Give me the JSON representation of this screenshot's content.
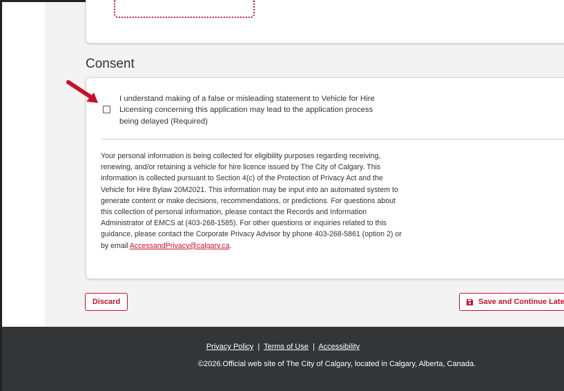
{
  "consent": {
    "title": "Consent",
    "checkbox_label": "I understand making of a false or misleading statement to Vehicle for Hire Licensing concerning this application may lead to the application process being delayed (Required)",
    "privacy_text": "Your personal information is being collected for eligibility purposes regarding receiving, renewing, and/or retaining a vehicle for hire licence issued by The City of Calgary. This information is collected pursuant to Section 4(c) of the Protection of Privacy Act and the Vehicle for Hire Bylaw 20M2021. This information may be input into an automated system to generate content or make decisions, recommendations, or predictions. For questions about this collection of personal information, please contact the Records and Information Administrator of EMCS at (403-268-1585). For other questions or inquiries related to this guidance, please contact the Corporate Privacy Advisor by phone 403-268-5861 (option 2) or by email",
    "privacy_email": "AccessandPrivacy@calgary.ca",
    "privacy_end": "."
  },
  "actions": {
    "discard_label": "Discard",
    "save_label": "Save and Continue Late"
  },
  "footer": {
    "links": [
      "Privacy Policy",
      "Terms of Use",
      "Accessibility"
    ],
    "separator": "|",
    "copyright": "©2026.Official web site of The City of Calgary, located in Calgary, Alberta, Canada."
  },
  "colors": {
    "accent": "#c8102e",
    "footer_bg": "#333536",
    "page_bg": "#f3f3f3"
  },
  "icons": [
    "arrow-pointer-icon",
    "floppy-disk-icon"
  ]
}
